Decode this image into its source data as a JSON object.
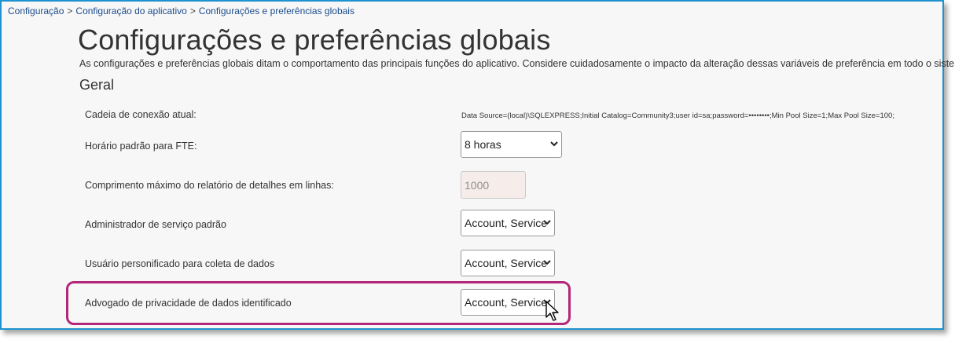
{
  "breadcrumb": {
    "items": [
      "Configuração",
      "Configuração do aplicativo",
      "Configurações e preferências globais"
    ],
    "separator": ">"
  },
  "page": {
    "title": "Configurações e preferências globais",
    "description": "As configurações e preferências globais ditam o comportamento das principais funções do aplicativo. Considere cuidadosamente o impacto da alteração dessas variáveis de preferência em todo o sistema.",
    "section": "Geral"
  },
  "settings": {
    "connection": {
      "label": "Cadeia de conexão atual:",
      "value": "Data Source=(local)\\SQLEXPRESS;Initial Catalog=Community3;user id=sa;password=••••••••;Min Pool Size=1;Max Pool Size=100;"
    },
    "fte": {
      "label": "Horário padrão para FTE:",
      "value": "8 horas"
    },
    "max_report": {
      "label": "Comprimento máximo do relatório de detalhes em linhas:",
      "value": "1000"
    },
    "service_admin": {
      "label": "Administrador de serviço padrão",
      "value": "Account, Service"
    },
    "impersonated_user": {
      "label": "Usuário personificado para coleta de dados",
      "value": "Account, Service"
    },
    "privacy_advocate": {
      "label": "Advogado de privacidade de dados identificado",
      "value": "Account, Service"
    }
  },
  "icons": {
    "chevron": "chevron-down-icon",
    "cursor": "mouse-pointer-icon"
  },
  "colors": {
    "frame_border": "#1f93cf",
    "highlight": "#b3267a",
    "link": "#1a4b8c"
  }
}
